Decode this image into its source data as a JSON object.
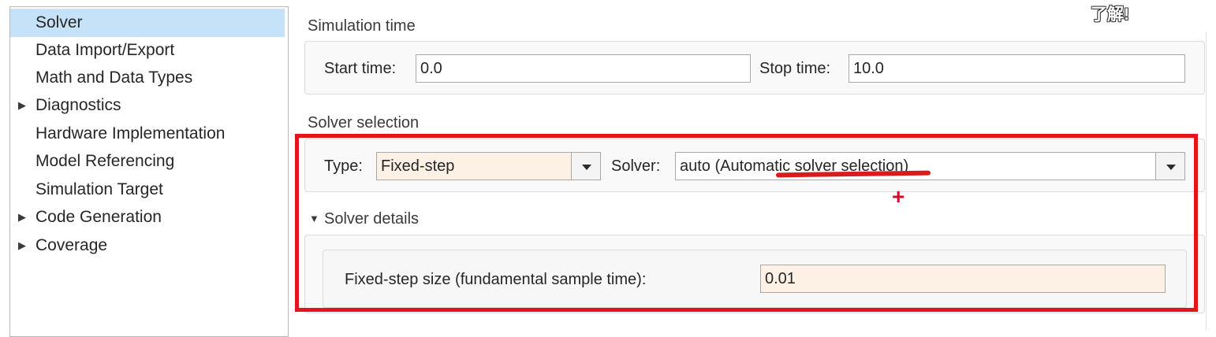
{
  "sidebar": {
    "items": [
      {
        "label": "Solver",
        "has_arrow": false,
        "selected": true
      },
      {
        "label": "Data Import/Export",
        "has_arrow": false
      },
      {
        "label": "Math and Data Types",
        "has_arrow": false
      },
      {
        "label": "Diagnostics",
        "has_arrow": true
      },
      {
        "label": "Hardware Implementation",
        "has_arrow": false
      },
      {
        "label": "Model Referencing",
        "has_arrow": false
      },
      {
        "label": "Simulation Target",
        "has_arrow": false
      },
      {
        "label": "Code Generation",
        "has_arrow": true
      },
      {
        "label": "Coverage",
        "has_arrow": true
      }
    ],
    "collapsed_arrow_glyph": "▶"
  },
  "simulation_time": {
    "title": "Simulation time",
    "start_label": "Start time:",
    "start_value": "0.0",
    "stop_label": "Stop time:",
    "stop_value": "10.0"
  },
  "solver_selection": {
    "title": "Solver selection",
    "type_label": "Type:",
    "type_value": "Fixed-step",
    "solver_label": "Solver:",
    "solver_value": "auto (Automatic solver selection)"
  },
  "solver_details": {
    "toggle_glyph": "▼",
    "title": "Solver details",
    "step_label": "Fixed-step size (fundamental sample time):",
    "step_value": "0.01"
  },
  "overlay_note": "了解!",
  "annotation_plus": "+",
  "colors": {
    "selection": "#c6e2f8",
    "annotation_red": "#e5141c",
    "tinted_field": "#fdf1e6"
  }
}
